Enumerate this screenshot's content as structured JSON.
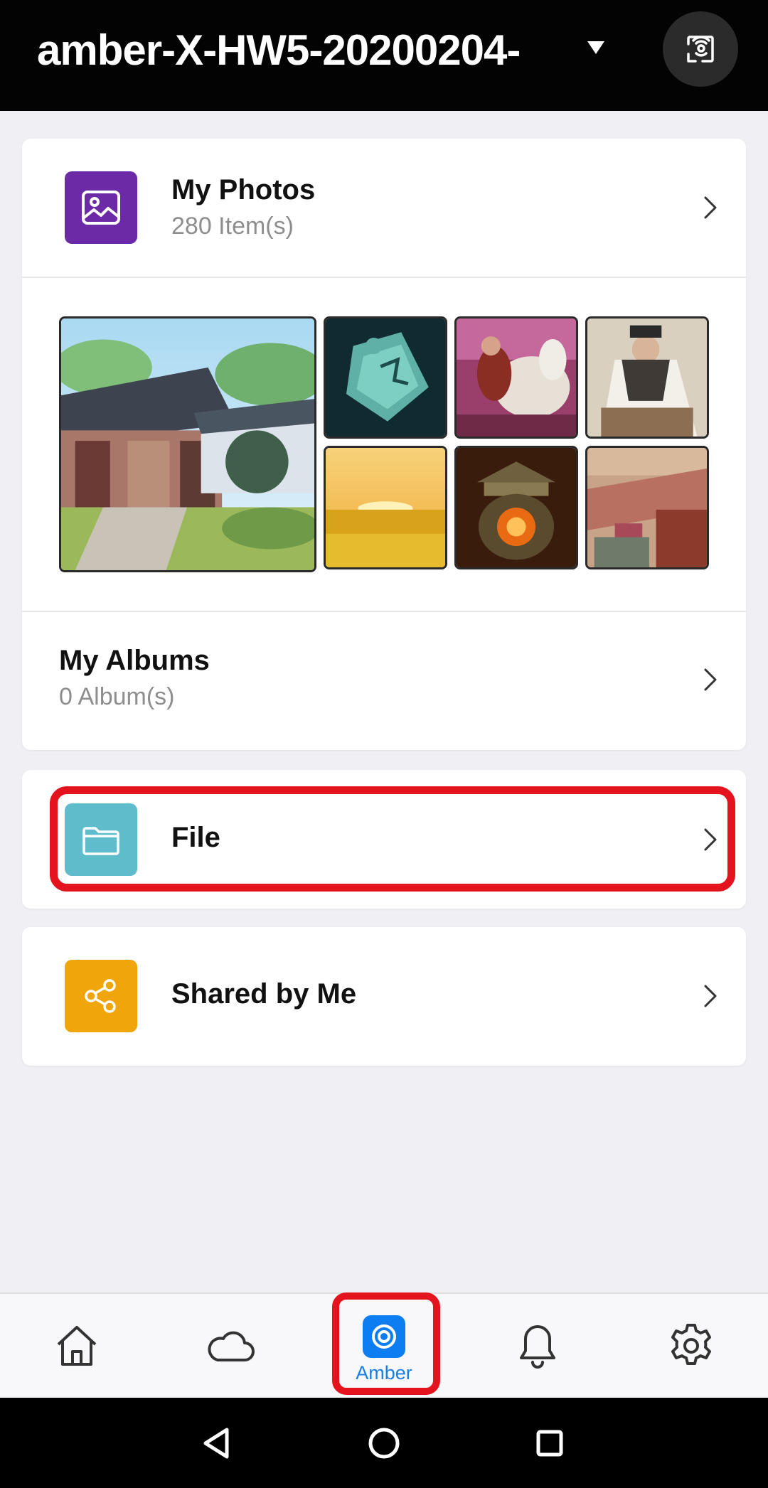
{
  "header": {
    "device_name": "amber-X-HW5-20200204-",
    "dropdown_icon": "caret-down-icon",
    "cast_icon": "cast-icon"
  },
  "photos": {
    "title": "My Photos",
    "count": "280 Item(s)",
    "icon": "image-icon",
    "icon_color": "#6c2aa6",
    "thumbnails": [
      "courtyard",
      "jade-badge",
      "rider-on-horse",
      "scholar-reading",
      "golden-field",
      "lantern-pavilion",
      "market-street"
    ]
  },
  "albums": {
    "title": "My Albums",
    "count": "0 Album(s)"
  },
  "file": {
    "title": "File",
    "icon": "folder-icon",
    "icon_color": "#5fbccb"
  },
  "shared": {
    "title": "Shared by Me",
    "icon": "share-icon",
    "icon_color": "#f0a50a"
  },
  "bottom_nav": {
    "items": [
      {
        "icon": "home-icon",
        "label": ""
      },
      {
        "icon": "cloud-icon",
        "label": ""
      },
      {
        "icon": "amber-icon",
        "label": "Amber"
      },
      {
        "icon": "bell-icon",
        "label": ""
      },
      {
        "icon": "gear-icon",
        "label": ""
      }
    ],
    "active_color": "#1a7fe0"
  },
  "highlight_color": "#e3141d"
}
